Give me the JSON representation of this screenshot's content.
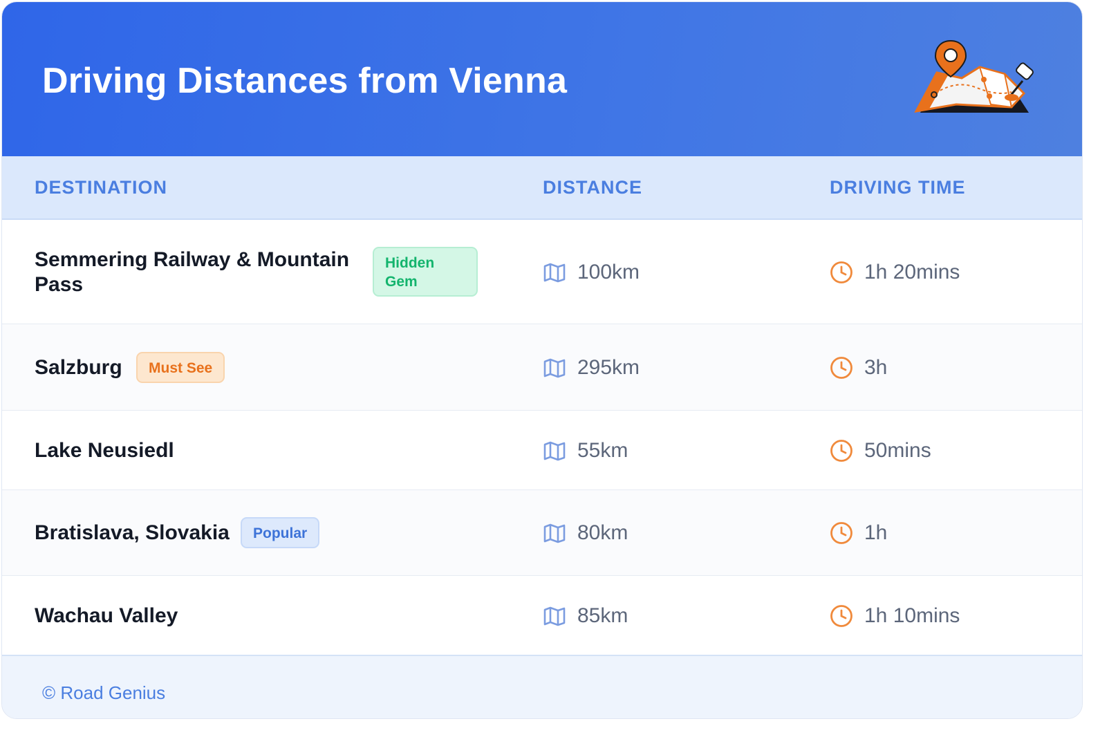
{
  "header": {
    "title": "Driving Distances from Vienna",
    "illustration_icon": "map-pin-illustration"
  },
  "table": {
    "columns": [
      "DESTINATION",
      "DISTANCE",
      "DRIVING TIME"
    ],
    "rows": [
      {
        "destination_line1": "Semmering Railway & Mountain",
        "destination_line2": "Pass",
        "badge_line1": "Hidden",
        "badge_line2": "Gem",
        "badge_color": "#13b46d",
        "distance": "100km",
        "time": "1h 20mins"
      },
      {
        "destination": "Salzburg",
        "badge": "Must See",
        "badge_color": "#e8711c",
        "distance": "295km",
        "time": "3h"
      },
      {
        "destination": "Lake Neusiedl",
        "distance": "55km",
        "time": "50mins"
      },
      {
        "destination": "Bratislava, Slovakia",
        "badge": "Popular",
        "badge_color": "#3d73d8",
        "distance": "80km",
        "time": "1h"
      },
      {
        "destination": "Wachau Valley",
        "distance": "85km",
        "time": "1h 10mins"
      }
    ],
    "distance_icon": "map-icon",
    "time_icon": "clock-icon"
  },
  "footer": {
    "credit": "© Road Genius"
  },
  "colors": {
    "header": "#2f66e8",
    "accent": "#4a7ee0",
    "clock": "#f08a3c",
    "map": "#7b9ce0"
  }
}
